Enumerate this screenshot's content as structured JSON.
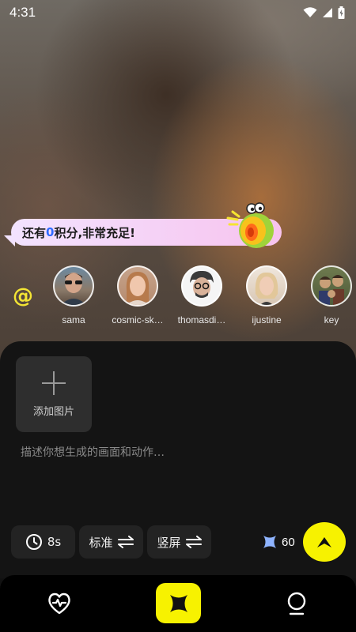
{
  "status_bar": {
    "time": "4:31"
  },
  "bubble": {
    "prefix": "还有",
    "points": "0",
    "suffix": "积分,非常充足!"
  },
  "mention": {
    "symbol": "@"
  },
  "avatars": [
    {
      "name": "sama"
    },
    {
      "name": "cosmic-sk…"
    },
    {
      "name": "thomasdi…"
    },
    {
      "name": "ijustine"
    },
    {
      "name": "key"
    }
  ],
  "add_image": {
    "label": "添加图片"
  },
  "prompt": {
    "placeholder": "描述你想生成的画面和动作…"
  },
  "options": {
    "duration": "8s",
    "quality": "标准",
    "orientation": "竖屏"
  },
  "credits": {
    "value": "60"
  },
  "colors": {
    "accent": "#f7f200",
    "points": "#2f6bff",
    "mention": "#f4e534"
  },
  "icons": {
    "duration": "clock-icon",
    "switch": "swap-icon",
    "credits": "sparkle-icon",
    "generate": "chevron-up-icon",
    "nav_left": "heart-pulse-icon",
    "nav_center": "sparkle-icon",
    "nav_right": "lamp-icon"
  }
}
